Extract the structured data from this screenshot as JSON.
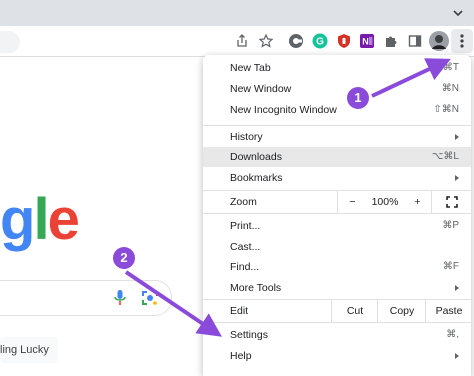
{
  "colors": {
    "annotation": "#8a4bdb",
    "google_g": "#4285f4",
    "google_l": "#34a853",
    "google_e": "#ea4335",
    "highlight": "#e8e8e8"
  },
  "page": {
    "logo_fragment": [
      "g",
      "l",
      "e"
    ],
    "lucky_button": "ling Lucky"
  },
  "toolbar_icons": [
    "share-icon",
    "bookmark-star-icon",
    "extension-c-icon",
    "grammarly-icon",
    "extension-red-icon",
    "onenote-icon",
    "puzzle-icon",
    "side-panel-icon",
    "profile-avatar",
    "kebab-menu-icon"
  ],
  "menu": {
    "new_tab": {
      "label": "New Tab",
      "shortcut": "⌘T"
    },
    "new_window": {
      "label": "New Window",
      "shortcut": "⌘N"
    },
    "new_incognito": {
      "label": "New Incognito Window",
      "shortcut": "⇧⌘N"
    },
    "history": {
      "label": "History"
    },
    "downloads": {
      "label": "Downloads",
      "shortcut": "⌥⌘L"
    },
    "bookmarks": {
      "label": "Bookmarks"
    },
    "zoom": {
      "label": "Zoom",
      "minus": "−",
      "value": "100%",
      "plus": "+"
    },
    "print": {
      "label": "Print...",
      "shortcut": "⌘P"
    },
    "cast": {
      "label": "Cast..."
    },
    "find": {
      "label": "Find...",
      "shortcut": "⌘F"
    },
    "more_tools": {
      "label": "More Tools"
    },
    "edit": {
      "label": "Edit",
      "cut": "Cut",
      "copy": "Copy",
      "paste": "Paste"
    },
    "settings": {
      "label": "Settings",
      "shortcut": "⌘,"
    },
    "help": {
      "label": "Help"
    }
  },
  "annotations": {
    "one": "1",
    "two": "2"
  }
}
